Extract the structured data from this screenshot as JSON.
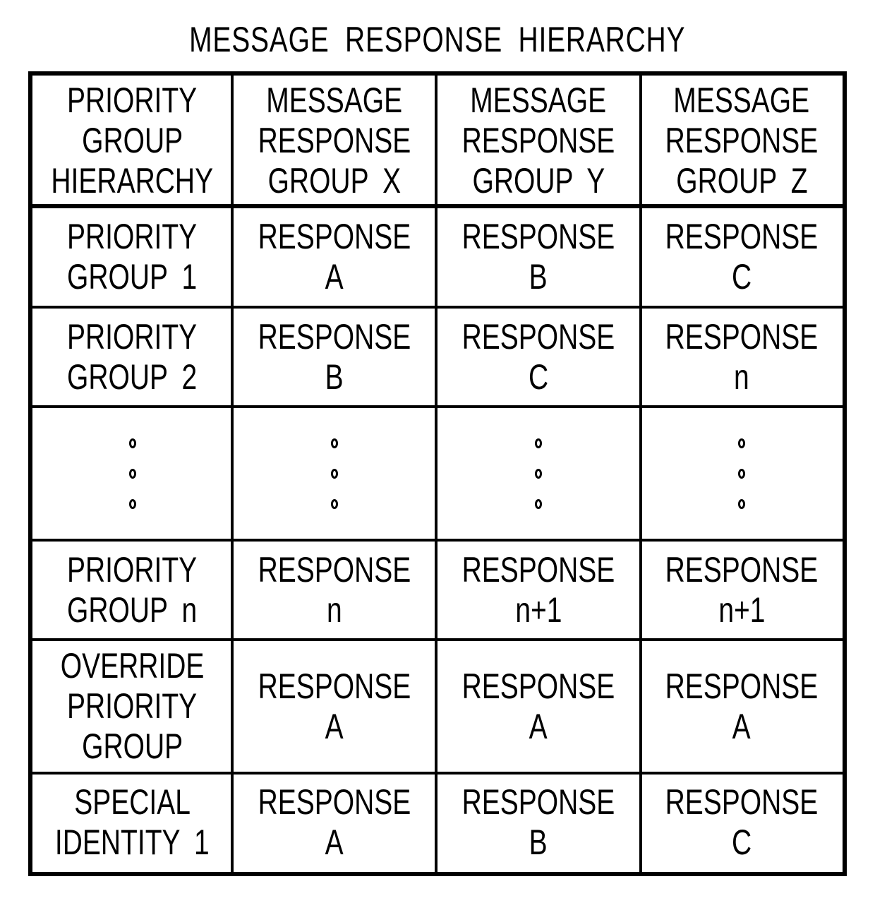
{
  "title": "MESSAGE RESPONSE HIERARCHY",
  "table": {
    "header": [
      [
        "PRIORITY",
        "GROUP",
        "HIERARCHY"
      ],
      [
        "MESSAGE",
        "RESPONSE",
        "GROUP  X"
      ],
      [
        "MESSAGE",
        "RESPONSE",
        "GROUP  Y"
      ],
      [
        "MESSAGE",
        "RESPONSE",
        "GROUP  Z"
      ]
    ],
    "rows": [
      {
        "kind": "text",
        "cells": [
          [
            "PRIORITY",
            "GROUP  1"
          ],
          [
            "RESPONSE",
            "A"
          ],
          [
            "RESPONSE",
            "B"
          ],
          [
            "RESPONSE",
            "C"
          ]
        ]
      },
      {
        "kind": "text",
        "cells": [
          [
            "PRIORITY",
            "GROUP  2"
          ],
          [
            "RESPONSE",
            "B"
          ],
          [
            "RESPONSE",
            "C"
          ],
          [
            "RESPONSE",
            "n"
          ]
        ]
      },
      {
        "kind": "ellipsis",
        "dot_count": 3
      },
      {
        "kind": "text",
        "cells": [
          [
            "PRIORITY",
            "GROUP  n"
          ],
          [
            "RESPONSE",
            "n"
          ],
          [
            "RESPONSE",
            "n+1"
          ],
          [
            "RESPONSE",
            "n+1"
          ]
        ]
      },
      {
        "kind": "text",
        "cells": [
          [
            "OVERRIDE",
            "PRIORITY",
            "GROUP"
          ],
          [
            "RESPONSE",
            "A"
          ],
          [
            "RESPONSE",
            "A"
          ],
          [
            "RESPONSE",
            "A"
          ]
        ]
      },
      {
        "kind": "text",
        "cells": [
          [
            "SPECIAL",
            "IDENTITY  1"
          ],
          [
            "RESPONSE",
            "A"
          ],
          [
            "RESPONSE",
            "B"
          ],
          [
            "RESPONSE",
            "C"
          ]
        ]
      }
    ]
  }
}
